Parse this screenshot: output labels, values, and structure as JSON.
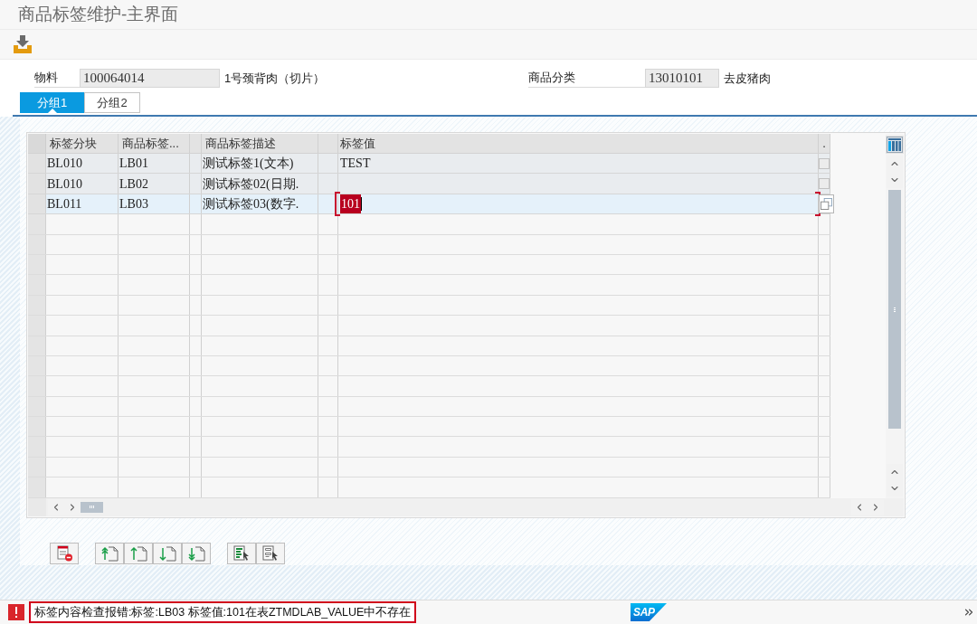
{
  "window": {
    "title": "商品标签维护-主界面"
  },
  "header_fields": [
    {
      "label": "物料",
      "value": "100064014",
      "description": "1号颈背肉（切片）"
    },
    {
      "label": "商品分类",
      "value": "13010101",
      "description": "去皮猪肉"
    }
  ],
  "tabs": [
    {
      "label": "分组1",
      "selected": true
    },
    {
      "label": "分组2",
      "selected": false
    }
  ],
  "table": {
    "columns": [
      {
        "label": "标签分块"
      },
      {
        "label": "商品标签..."
      },
      {
        "label": "商品标签描述"
      },
      {
        "label": "标签值"
      },
      {
        "label": "."
      }
    ],
    "rows": [
      {
        "block": "BL010",
        "tag": "LB01",
        "description": "测试标签1(文本)",
        "value": "TEST",
        "selected": false,
        "error": false,
        "last_cell": {
          "kind": "checkbox",
          "checked": false
        }
      },
      {
        "block": "BL010",
        "tag": "LB02",
        "description": "测试标签02(日期.",
        "selected": false,
        "error": false,
        "last_cell": {
          "kind": "checkbox",
          "checked": false
        }
      },
      {
        "block": "BL011",
        "tag": "LB03",
        "description": "测试标签03(数字.",
        "value": "101",
        "selected": true,
        "error": true,
        "last_cell": {
          "kind": "value_help"
        }
      }
    ]
  },
  "status_bar": {
    "message": "标签内容检查报错:标签:LB03 标签值:101在表ZTMDLAB_VALUE中不存在",
    "logo": "SAP"
  }
}
